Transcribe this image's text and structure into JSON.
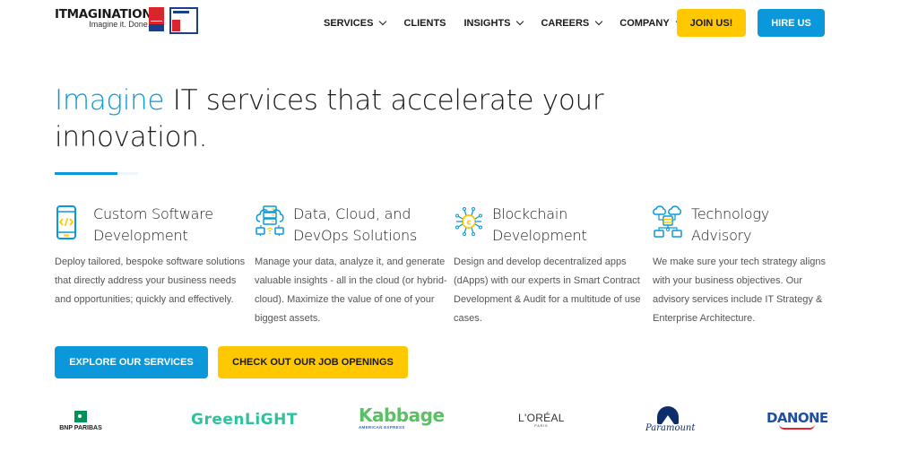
{
  "header": {
    "brand_name": "ITMAGINATION",
    "brand_tagline": "Imagine it. Done.",
    "badges": [
      "great-place-to-work-badge",
      "best-workplaces-badge"
    ],
    "nav": [
      {
        "label": "SERVICES",
        "has_dropdown": true
      },
      {
        "label": "CLIENTS",
        "has_dropdown": false
      },
      {
        "label": "INSIGHTS",
        "has_dropdown": true
      },
      {
        "label": "CAREERS",
        "has_dropdown": true
      },
      {
        "label": "COMPANY",
        "has_dropdown": true
      }
    ],
    "join_label": "JOIN US!",
    "hire_label": "HIRE US"
  },
  "hero": {
    "title_accent": "Imagine",
    "title_rest": " IT services that accelerate your innovation."
  },
  "services": [
    {
      "icon": "mobile-code-icon",
      "title": "Custom Software Development",
      "description": "Deploy tailored, bespoke software solutions that directly address your business needs and opportunities; quickly and effectively."
    },
    {
      "icon": "server-cloud-icon",
      "title": "Data, Cloud, and DevOps Solutions",
      "description": "Manage your data, analyze it, and generate valuable insights - all in the cloud (or hybrid-cloud). Maximize the value of one of your biggest assets."
    },
    {
      "icon": "blockchain-coin-icon",
      "title": "Blockchain Development",
      "description": "Design and develop decentralized apps (dApps) with our experts in Smart Contract Development & Audit for a multitude of use cases."
    },
    {
      "icon": "cloud-network-icon",
      "title": "Technology Advisory",
      "description": "We make sure your tech strategy aligns with your business objectives. Our advisory services include IT Strategy & Enterprise Architecture."
    }
  ],
  "cta": {
    "explore_label": "EXPLORE OUR SERVICES",
    "jobs_label": "CHECK OUT OUR JOB OPENINGS"
  },
  "clients": {
    "bnp": "BNP PARIBAS",
    "greenlight": "GreenLiGHT",
    "kabbage": "Kabbage",
    "kabbage_sub": "AMERICAN EXPRESS",
    "loreal": "L'ORÉAL",
    "loreal_sub": "PARIS",
    "paramount": "Paramount",
    "danone": "DANONE"
  },
  "colors": {
    "accent_blue": "#0b98da",
    "accent_yellow": "#ffc800"
  }
}
